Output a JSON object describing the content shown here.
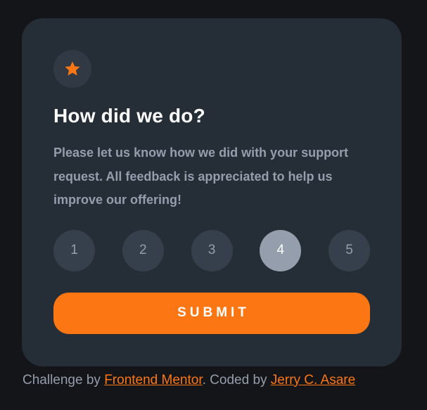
{
  "card": {
    "icon": "star-icon",
    "title": "How did we do?",
    "description": "Please let us know how we did with your support request. All feedback is appreciated to help us improve our offering!",
    "ratings": [
      "1",
      "2",
      "3",
      "4",
      "5"
    ],
    "selected_rating": "4",
    "submit_label": "SUBMIT"
  },
  "attribution": {
    "prefix": "Challenge by ",
    "challenge_link": "Frontend Mentor",
    "middle": ". Coded by ",
    "author_link": "Jerry C. Asare"
  },
  "colors": {
    "background": "#131518",
    "card": "#252d37",
    "accent": "#fc7614",
    "muted_text": "#959eac",
    "rating_bg": "#363f4c",
    "rating_selected_bg": "#959eac"
  }
}
